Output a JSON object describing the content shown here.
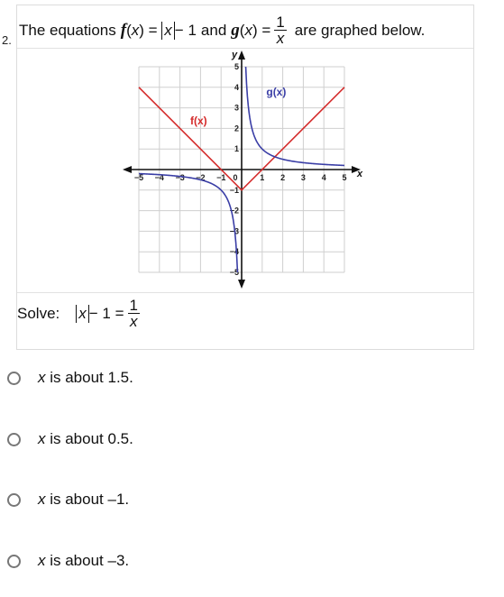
{
  "question": {
    "number": "2.",
    "title": {
      "prefix": "The equations",
      "f_name": "f",
      "f_rhs_var": "x",
      "f_rhs_tail": "− 1",
      "conj": "and",
      "g_name": "g",
      "g_num": "1",
      "g_den": "x",
      "suffix": "are graphed below."
    },
    "solve": {
      "label": "Solve:",
      "lhs_var": "x",
      "lhs_tail": "− 1 =",
      "rhs_num": "1",
      "rhs_den": "x"
    },
    "options": [
      {
        "var": "x",
        "text": " is about 1.5.",
        "selected": false
      },
      {
        "var": "x",
        "text": " is about 0.5.",
        "selected": false
      },
      {
        "var": "x",
        "text": " is about –1.",
        "selected": false
      },
      {
        "var": "x",
        "text": " is about –3.",
        "selected": false
      }
    ]
  },
  "chart_data": {
    "type": "line",
    "title": "",
    "xlabel": "x",
    "ylabel": "y",
    "xlim": [
      -5,
      5
    ],
    "ylim": [
      -5,
      5
    ],
    "grid": true,
    "x_ticks": [
      "−5",
      "−4",
      "−3",
      "−2",
      "−1",
      "0",
      "1",
      "2",
      "3",
      "4",
      "5"
    ],
    "y_ticks": [
      "−5",
      "−4",
      "−3",
      "−2",
      "−1",
      "1",
      "2",
      "3",
      "4",
      "5"
    ],
    "series": [
      {
        "name": "f(x)",
        "label_fn": "f",
        "label_var": "x",
        "color": "#d42a2a",
        "expression": "|x| - 1",
        "points": [
          [
            -5,
            4
          ],
          [
            0,
            -1
          ],
          [
            5,
            4
          ]
        ]
      },
      {
        "name": "g(x)",
        "label_fn": "g",
        "label_var": "x",
        "color": "#3a3ea6",
        "expression": "1/x",
        "domain_positive": [
          0.2,
          5
        ],
        "domain_negative": [
          -5,
          -0.2
        ]
      }
    ],
    "annotations": [
      {
        "text": "f(x)",
        "at": [
          -2.5,
          2.2
        ],
        "color": "#d42a2a"
      },
      {
        "text": "g(x)",
        "at": [
          1.2,
          3.6
        ],
        "color": "#3a3ea6"
      }
    ]
  }
}
